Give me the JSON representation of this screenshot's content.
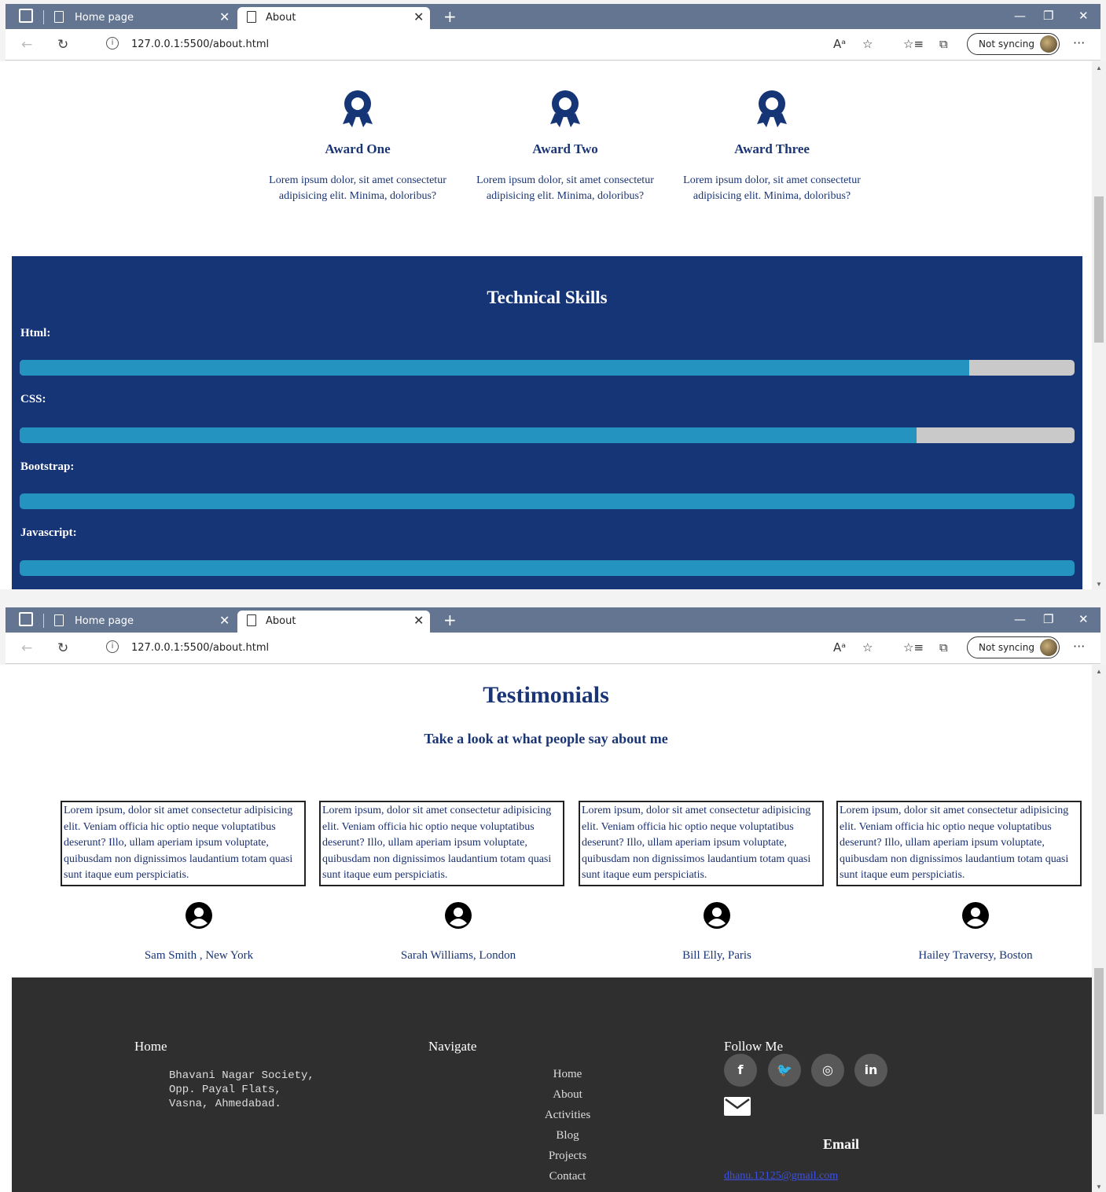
{
  "browser": {
    "tabs": [
      {
        "label": "Home page",
        "active": false
      },
      {
        "label": "About",
        "active": true
      }
    ],
    "url": "127.0.0.1:5500/about.html",
    "sync_label": "Not syncing"
  },
  "awards": [
    {
      "title": "Award One",
      "text": "Lorem ipsum dolor, sit amet consectetur adipisicing elit. Minima, doloribus?"
    },
    {
      "title": "Award Two",
      "text": "Lorem ipsum dolor, sit amet consectetur adipisicing elit. Minima, doloribus?"
    },
    {
      "title": "Award Three",
      "text": "Lorem ipsum dolor, sit amet consectetur adipisicing elit. Minima, doloribus?"
    }
  ],
  "skills": {
    "title": "Technical Skills",
    "items": [
      {
        "label": "Html:",
        "percent": 90
      },
      {
        "label": "CSS:",
        "percent": 85
      },
      {
        "label": "Bootstrap:",
        "percent": 100
      },
      {
        "label": "Javascript:",
        "percent": 100
      }
    ]
  },
  "testimonials": {
    "title": "Testimonials",
    "subtitle": "Take a look at what people say about me",
    "items": [
      {
        "text": "Lorem ipsum, dolor sit amet consectetur adipisicing elit. Veniam officia hic optio neque voluptatibus deserunt? Illo, ullam aperiam ipsum voluptate, quibusdam non dignissimos laudantium totam quasi sunt itaque eum perspiciatis.",
        "name": "Sam Smith , New York"
      },
      {
        "text": "Lorem ipsum, dolor sit amet consectetur adipisicing elit. Veniam officia hic optio neque voluptatibus deserunt? Illo, ullam aperiam ipsum voluptate, quibusdam non dignissimos laudantium totam quasi sunt itaque eum perspiciatis.",
        "name": "Sarah Williams, London"
      },
      {
        "text": "Lorem ipsum, dolor sit amet consectetur adipisicing elit. Veniam officia hic optio neque voluptatibus deserunt? Illo, ullam aperiam ipsum voluptate, quibusdam non dignissimos laudantium totam quasi sunt itaque eum perspiciatis.",
        "name": "Bill Elly, Paris"
      },
      {
        "text": "Lorem ipsum, dolor sit amet consectetur adipisicing elit. Veniam officia hic optio neque voluptatibus deserunt? Illo, ullam aperiam ipsum voluptate, quibusdam non dignissimos laudantium totam quasi sunt itaque eum perspiciatis.",
        "name": "Hailey Traversy, Boston"
      }
    ]
  },
  "footer": {
    "home_heading": "Home",
    "address": "Bhavani Nagar Society,\nOpp. Payal Flats,\nVasna, Ahmedabad.",
    "navigate_heading": "Navigate",
    "nav_links": [
      "Home",
      "About",
      "Activities",
      "Blog",
      "Projects",
      "Contact"
    ],
    "follow_heading": "Follow Me",
    "socials": [
      {
        "icon": "facebook-icon",
        "glyph": "f"
      },
      {
        "icon": "twitter-icon",
        "glyph": "🐦"
      },
      {
        "icon": "instagram-icon",
        "glyph": "◎"
      },
      {
        "icon": "linkedin-icon",
        "glyph": "in"
      }
    ],
    "email_heading": "Email",
    "email": "dhanu.12125@gmail.com"
  },
  "colors": {
    "navy": "#163576",
    "bar_fill": "#2493c0",
    "bar_track": "#c9c9c9",
    "footer_bg": "#2f2f2f"
  }
}
